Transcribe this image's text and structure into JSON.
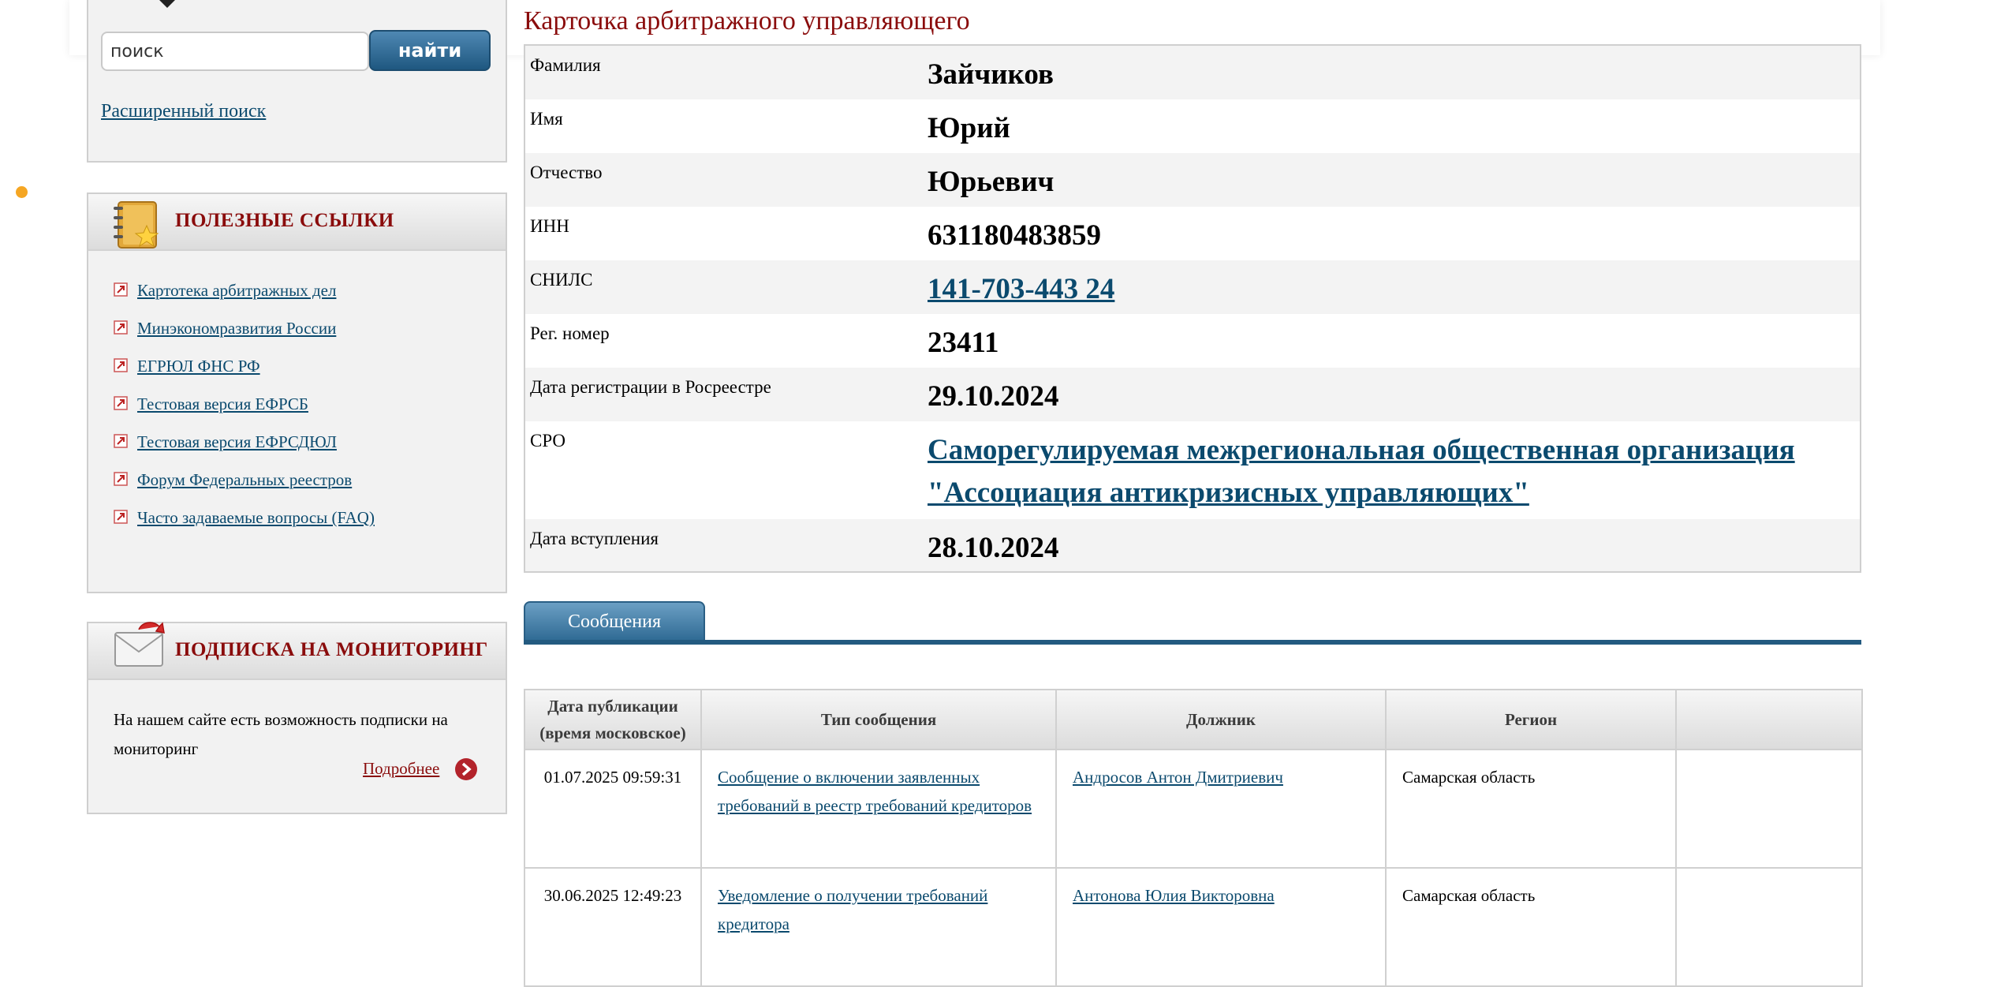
{
  "search": {
    "placeholder": "поиск",
    "value": "поиск",
    "button_label": "найти",
    "advanced_link": "Расширенный поиск"
  },
  "useful_links": {
    "title": "ПОЛЕЗНЫЕ ССЫЛКИ",
    "items": [
      "Картотека арбитражных дел",
      "Минэкономразвития России",
      "ЕГРЮЛ ФНС РФ",
      "Тестовая версия ЕФРСБ",
      "Тестовая версия ЕФРСДЮЛ",
      "Форум Федеральных реестров",
      "Часто задаваемые вопросы (FAQ)"
    ]
  },
  "monitoring": {
    "title": "ПОДПИСКА НА МОНИТОРИНГ",
    "text": "На нашем сайте есть возможность подписки на мониторинг",
    "more_link": "Подробнее"
  },
  "card": {
    "title": "Карточка арбитражного управляющего",
    "rows": [
      {
        "label": "Фамилия",
        "value": "Зайчиков"
      },
      {
        "label": "Имя",
        "value": "Юрий"
      },
      {
        "label": "Отчество",
        "value": "Юрьевич"
      },
      {
        "label": "ИНН",
        "value": "631180483859"
      },
      {
        "label": "СНИЛС",
        "value": "141-703-443 24"
      },
      {
        "label": "Рег. номер",
        "value": "23411"
      },
      {
        "label": "Дата регистрации в Росреестре",
        "value": "29.10.2024"
      },
      {
        "label": "СРО",
        "value": "Саморегулируемая межрегиональная общественная организация \"Ассоциация антикризисных управляющих\""
      },
      {
        "label": "Дата вступления",
        "value": "28.10.2024"
      }
    ]
  },
  "tabs": {
    "messages": "Сообщения"
  },
  "messages_table": {
    "headers": [
      "Дата публикации (время московское)",
      "Тип сообщения",
      "Должник",
      "Регион",
      ""
    ],
    "rows": [
      {
        "date": "01.07.2025 09:59:31",
        "type": "Сообщение о включении заявленных требований в реестр требований кредиторов",
        "debtor": "Андросов Антон Дмитриевич",
        "region": "Самарская область"
      },
      {
        "date": "30.06.2025 12:49:23",
        "type": "Уведомление о получении требований кредитора",
        "debtor": "Антонова Юлия Викторовна",
        "region": "Самарская область"
      }
    ]
  },
  "colors": {
    "title_red": "#8a0c0c",
    "link_blue": "#0b4a6e",
    "tab_blue": "#235a80",
    "accent_orange": "#f5a623"
  }
}
